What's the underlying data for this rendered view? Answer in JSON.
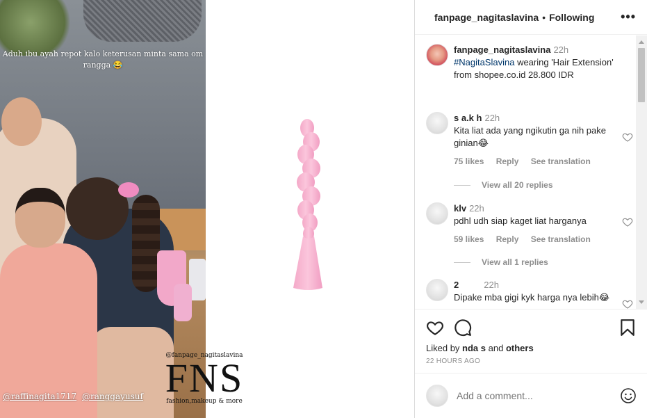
{
  "media": {
    "photo_caption": "Aduh ibu ayah repot kalo keterusan minta sama om rangga 😂",
    "tags": [
      "@raffinagita1717",
      "@ranggayusuf"
    ],
    "watermark": {
      "handle": "@fanpage_nagitaslavina",
      "logo": "FNS",
      "tagline": "fashion,makeup & more"
    }
  },
  "header": {
    "username": "fanpage_nagitaslavina",
    "separator": "•",
    "follow_status": "Following",
    "more": "•••"
  },
  "post_caption": {
    "username": "fanpage_nagitaslavina",
    "time": "22h",
    "hashtag": "#NagitaSlavina",
    "text": " wearing 'Hair Extension' from shopee.co.id 28.800 IDR"
  },
  "comments": [
    {
      "username": "s  a.k  h",
      "time": "22h",
      "text": "Kita liat ada yang ngikutin ga nih pake ginian😂",
      "likes": "75 likes",
      "reply": "Reply",
      "translate": "See translation",
      "view_replies": "View all 20 replies"
    },
    {
      "username": "          klv",
      "time": "22h",
      "text": "pdhl udh siap kaget liat harganya",
      "likes": "59 likes",
      "reply": "Reply",
      "translate": "See translation",
      "view_replies": "View all 1 replies"
    },
    {
      "username": "2",
      "time": "22h",
      "text": "Dipake mba gigi kyk harga nya lebih😂"
    }
  ],
  "liked_by": {
    "prefix": "Liked by ",
    "name": "  nda    s",
    "middle": " and ",
    "others": "others"
  },
  "post_date": "22 HOURS AGO",
  "add_comment": {
    "placeholder": "Add a comment..."
  },
  "colors": {
    "link": "#00376b",
    "muted": "#8e8e8e",
    "product_pink": "#f7b8d3"
  },
  "icons": [
    "heart-icon",
    "comment-icon",
    "bookmark-icon",
    "emoji-icon",
    "more-icon"
  ]
}
